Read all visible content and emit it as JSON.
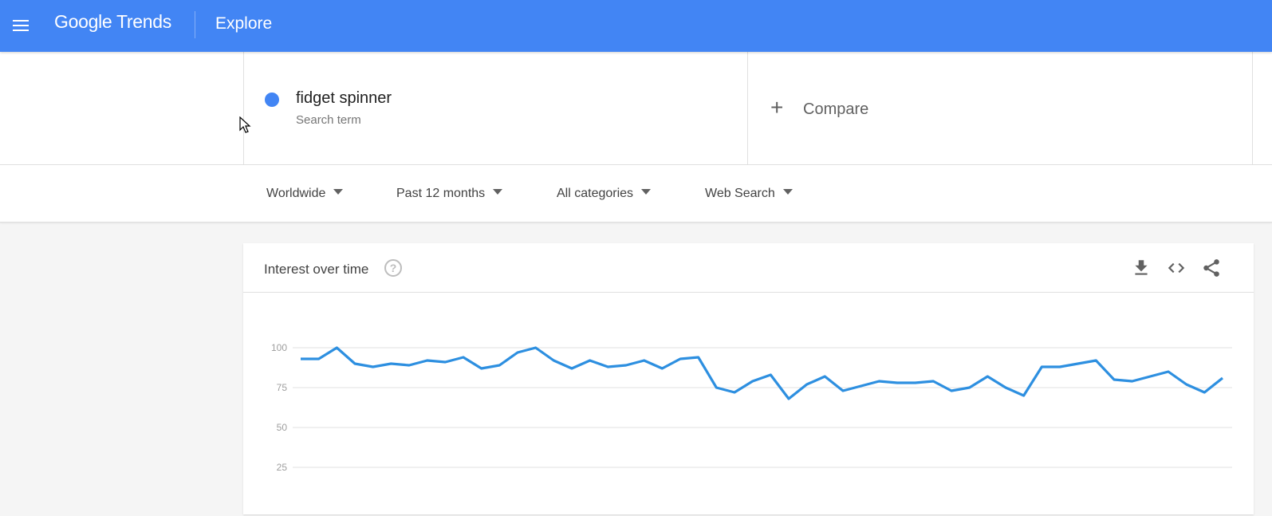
{
  "header": {
    "menu_icon": "hamburger-menu-icon",
    "logo_text": "Google Trends",
    "section_title": "Explore"
  },
  "search": {
    "term": "fidget spinner",
    "term_type": "Search term",
    "term_color": "#4285f4",
    "compare_label": "Compare",
    "compare_icon": "plus-icon"
  },
  "filters": [
    {
      "label": "Worldwide"
    },
    {
      "label": "Past 12 months"
    },
    {
      "label": "All categories"
    },
    {
      "label": "Web Search"
    }
  ],
  "card": {
    "title": "Interest over time",
    "help_icon": "help-circle-icon",
    "actions": [
      "download-icon",
      "embed-code-icon",
      "share-icon"
    ]
  },
  "chart_data": {
    "type": "line",
    "title": "Interest over time",
    "xlabel": "",
    "ylabel": "",
    "ylim": [
      0,
      100
    ],
    "yticks": [
      25,
      50,
      75,
      100
    ],
    "grid": true,
    "legend": "none",
    "line_color": "#2d8fe0",
    "series": [
      {
        "name": "fidget spinner",
        "values": [
          93,
          93,
          100,
          90,
          88,
          90,
          89,
          92,
          91,
          94,
          87,
          89,
          97,
          100,
          92,
          87,
          92,
          88,
          89,
          92,
          87,
          93,
          94,
          75,
          72,
          79,
          83,
          68,
          77,
          82,
          73,
          76,
          79,
          78,
          78,
          79,
          73,
          75,
          82,
          75,
          70,
          88,
          88,
          90,
          92,
          80,
          79,
          82,
          85,
          77,
          72,
          81
        ]
      }
    ]
  }
}
